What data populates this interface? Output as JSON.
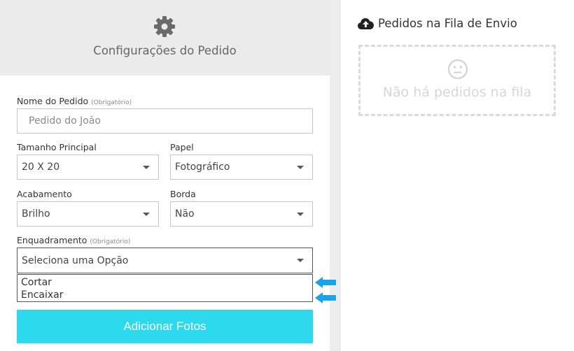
{
  "config": {
    "title": "Configurações do Pedido",
    "gear_icon": "gear-icon"
  },
  "form": {
    "order_name": {
      "label": "Nome do Pedido",
      "note": "(Obrigatório)",
      "placeholder": "Pedido do João"
    },
    "main_size": {
      "label": "Tamanho Principal",
      "value": "20 X 20"
    },
    "paper": {
      "label": "Papel",
      "value": "Fotográfico"
    },
    "finish": {
      "label": "Acabamento",
      "value": "Brilho"
    },
    "border": {
      "label": "Borda",
      "value": "Não"
    },
    "framing": {
      "label": "Enquadramento",
      "note": "(Obrigatório)",
      "value": "Seleciona uma Opção",
      "options": [
        "Cortar",
        "Encaixar"
      ]
    },
    "add_button": "Adicionar Fotos"
  },
  "queue": {
    "title": "Pedidos na Fila de Envio",
    "icon": "cloud-upload-icon",
    "empty_icon": "neutral-face-icon",
    "empty_text": "Não há pedidos na fila"
  },
  "colors": {
    "accent": "#2dd9ec",
    "annotation_arrow": "#1aa3e8"
  }
}
